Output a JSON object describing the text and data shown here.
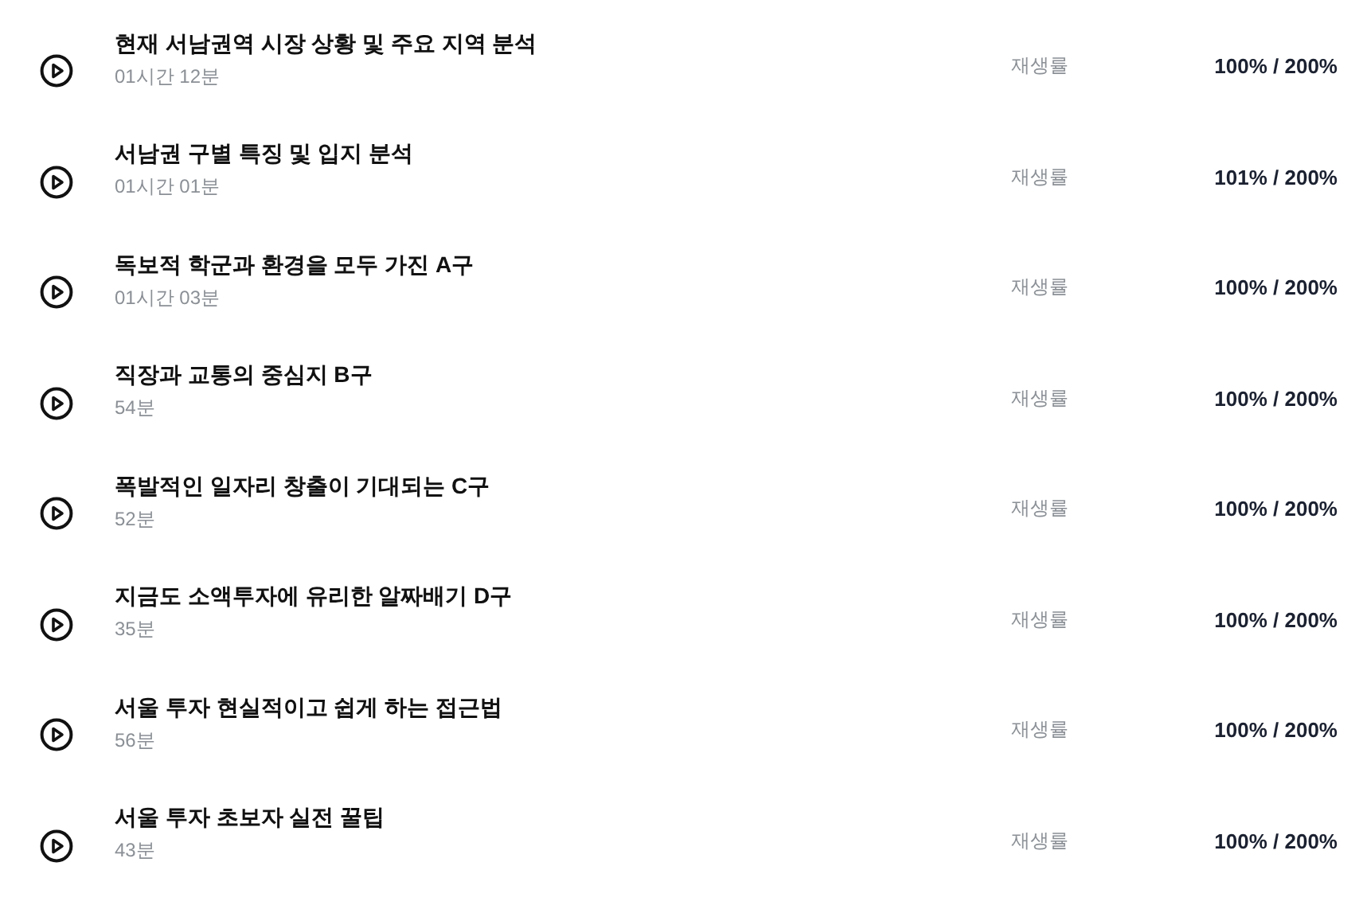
{
  "lectures": [
    {
      "title": "현재 서남권역 시장 상황 및 주요 지역 분석",
      "duration": "01시간 12분",
      "rate_label": "재생률",
      "rate": "100% / 200%"
    },
    {
      "title": "서남권 구별 특징 및 입지 분석",
      "duration": "01시간 01분",
      "rate_label": "재생률",
      "rate": "101% / 200%"
    },
    {
      "title": "독보적 학군과 환경을 모두 가진 A구",
      "duration": "01시간 03분",
      "rate_label": "재생률",
      "rate": "100% / 200%"
    },
    {
      "title": "직장과 교통의 중심지 B구",
      "duration": "54분",
      "rate_label": "재생률",
      "rate": "100% / 200%"
    },
    {
      "title": "폭발적인 일자리 창출이 기대되는 C구",
      "duration": "52분",
      "rate_label": "재생률",
      "rate": "100% / 200%"
    },
    {
      "title": "지금도 소액투자에 유리한 알짜배기 D구",
      "duration": "35분",
      "rate_label": "재생률",
      "rate": "100% / 200%"
    },
    {
      "title": "서울 투자 현실적이고 쉽게 하는 접근법",
      "duration": "56분",
      "rate_label": "재생률",
      "rate": "100% / 200%"
    },
    {
      "title": "서울 투자 초보자 실전 꿀팁",
      "duration": "43분",
      "rate_label": "재생률",
      "rate": "100% / 200%"
    }
  ]
}
